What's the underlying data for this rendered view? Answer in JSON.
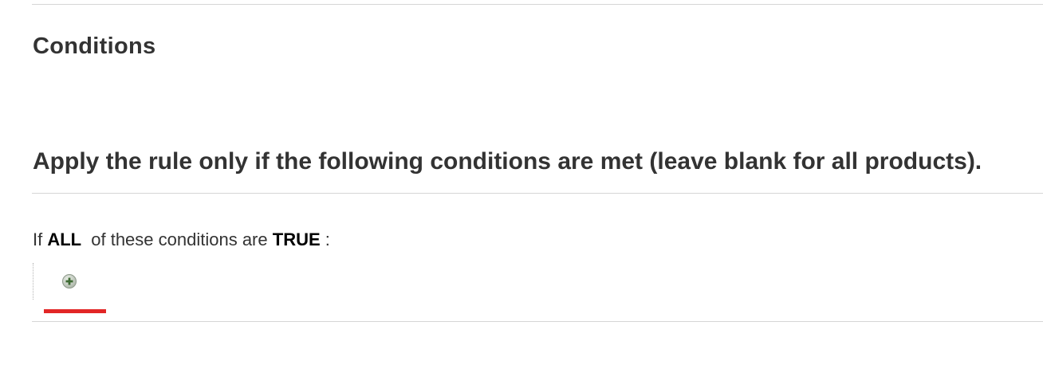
{
  "section": {
    "title": "Conditions"
  },
  "fieldset": {
    "legend": "Apply the rule only if the following conditions are met (leave blank for all products)."
  },
  "condition": {
    "prefix": "If",
    "aggregator": "ALL",
    "middle": "of these conditions are",
    "value": "TRUE",
    "suffix": ":"
  },
  "add_condition": {
    "icon": "plus-circle-icon"
  },
  "colors": {
    "accent_underline": "#e22626",
    "divider": "#d6d6d6",
    "text": "#333333"
  }
}
